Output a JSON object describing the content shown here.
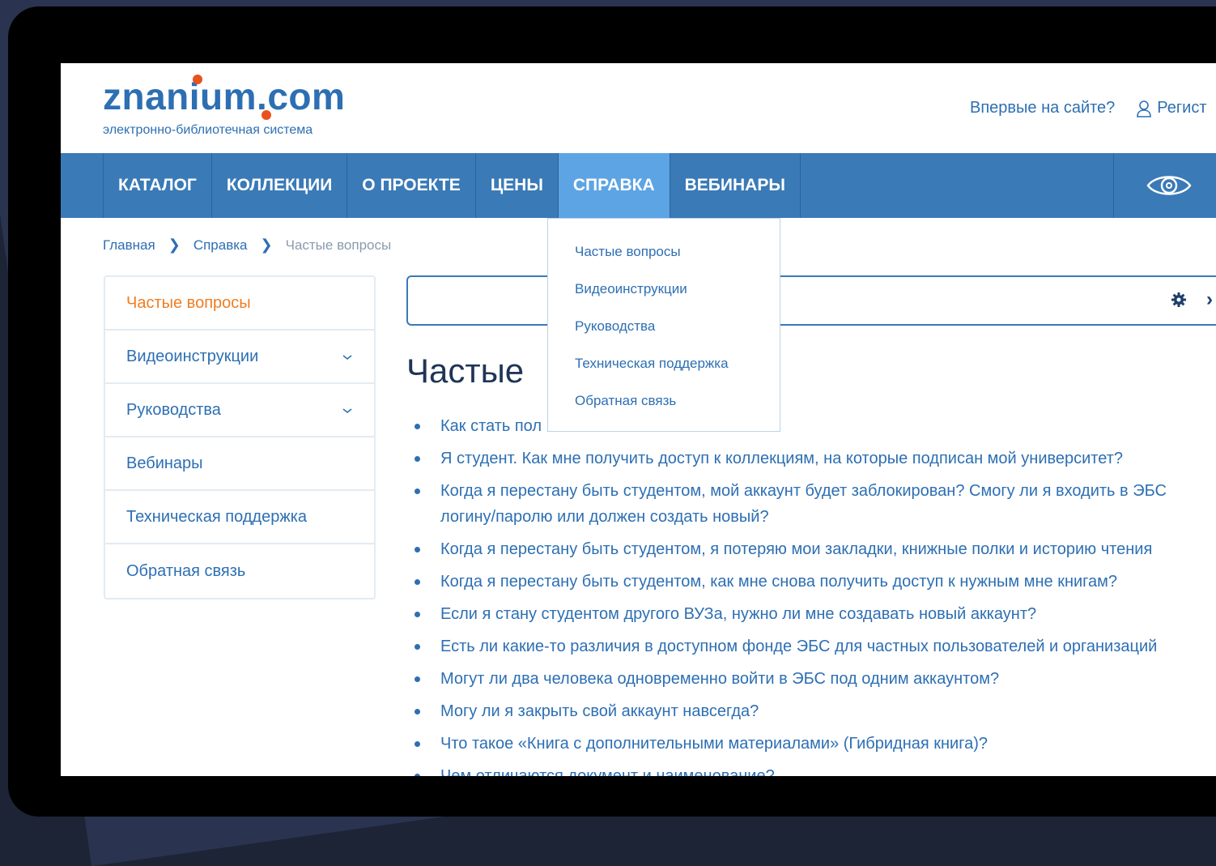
{
  "header": {
    "logo_text": "znanium.com",
    "logo_subtitle": "электронно-библиотечная система",
    "first_time": "Впервые на сайте?",
    "register": "Регист"
  },
  "nav": {
    "items": [
      {
        "label": "КАТАЛОГ"
      },
      {
        "label": "КОЛЛЕКЦИИ"
      },
      {
        "label": "О ПРОЕКТЕ"
      },
      {
        "label": "ЦЕНЫ"
      },
      {
        "label": "СПРАВКА"
      },
      {
        "label": "ВЕБИНАРЫ"
      }
    ],
    "active": "СПРАВКА"
  },
  "breadcrumb": {
    "items": [
      "Главная",
      "Справка",
      "Частые вопросы"
    ]
  },
  "dropdown": {
    "items": [
      "Частые вопросы",
      "Видеоинструкции",
      "Руководства",
      "Техническая поддержка",
      "Обратная связь"
    ]
  },
  "sidebar": {
    "items": [
      {
        "label": "Частые вопросы",
        "active": true,
        "expandable": false
      },
      {
        "label": "Видеоинструкции",
        "active": false,
        "expandable": true
      },
      {
        "label": "Руководства",
        "active": false,
        "expandable": true
      },
      {
        "label": "Вебинары",
        "active": false,
        "expandable": false
      },
      {
        "label": "Техническая поддержка",
        "active": false,
        "expandable": false
      },
      {
        "label": "Обратная связь",
        "active": false,
        "expandable": false
      }
    ]
  },
  "search": {
    "placeholder": ""
  },
  "page_title": "Частые",
  "faq": [
    "Как стать пол",
    "Я студент. Как мне получить доступ к коллекциям, на которые подписан мой университет?",
    "Когда я перестану быть студентом, мой аккаунт будет заблокирован? Смогу ли я входить в ЭБС",
    "логину/паролю или должен создать новый?",
    "Когда я перестану быть студентом, я потеряю мои закладки, книжные полки и историю чтения",
    "Когда я перестану быть студентом, как мне снова получить доступ к нужным мне книгам?",
    "Если я стану студентом другого ВУЗа, нужно ли мне создавать новый аккаунт?",
    "Есть ли какие-то различия в доступном фонде ЭБС для частных пользователей и организаций",
    "Могут ли два человека одновременно войти в ЭБС под одним аккаунтом?",
    "Могу ли я закрыть свой аккаунт навсегда?",
    "Что такое «Книга с дополнительными материалами» (Гибридная книга)?",
    "Чем отличаются документ и наименование?"
  ],
  "colors": {
    "brand": "#2d6fb3",
    "nav": "#3a7ab7",
    "nav_active": "#5da4e4",
    "accent": "#ef7d22",
    "logo_dot": "#e8521f"
  },
  "icons": {
    "user": "user-icon",
    "eye": "eye-icon",
    "gear": "gear-icon",
    "chevron": "chevron-down-icon",
    "arrow": "chevron-right-icon"
  }
}
